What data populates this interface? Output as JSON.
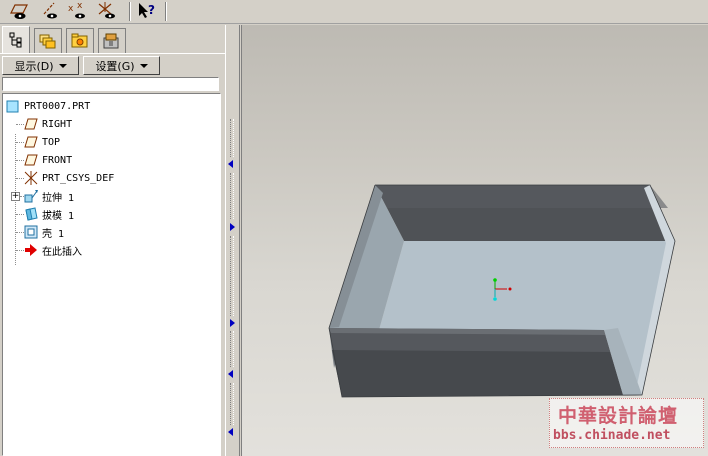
{
  "toolbar": {
    "buttons": [
      {
        "icon": "datum-plane-display-icon"
      },
      {
        "icon": "datum-axis-display-icon"
      },
      {
        "icon": "datum-point-display-icon"
      },
      {
        "icon": "csys-display-icon"
      },
      {
        "icon": "context-help-icon"
      }
    ]
  },
  "left_panel": {
    "tabs": [
      {
        "icon": "model-tree-icon",
        "active": true
      },
      {
        "icon": "folder-browser-icon",
        "active": false
      },
      {
        "icon": "favorites-icon",
        "active": false
      },
      {
        "icon": "connections-icon",
        "active": false
      }
    ],
    "show_menu_label": "显示(D)",
    "settings_menu_label": "设置(G)",
    "tree": {
      "root": "PRT0007.PRT",
      "items": [
        {
          "label": "RIGHT",
          "icon": "datum-plane-icon"
        },
        {
          "label": "TOP",
          "icon": "datum-plane-icon"
        },
        {
          "label": "FRONT",
          "icon": "datum-plane-icon"
        },
        {
          "label": "PRT_CSYS_DEF",
          "icon": "coordinate-system-icon"
        },
        {
          "label": "拉伸 1",
          "icon": "extrude-icon",
          "expandable": true
        },
        {
          "label": "拔模 1",
          "icon": "draft-icon"
        },
        {
          "label": "壳 1",
          "icon": "shell-icon"
        },
        {
          "label": "在此插入",
          "icon": "insert-here-arrow-icon"
        }
      ]
    }
  },
  "colors": {
    "ui_bg": "#d4d0c8",
    "model_dark": "#4d5054",
    "model_light": "#b5c2cb",
    "watermark": "#d06070"
  },
  "watermark": {
    "title": "中華設計論壇",
    "url": "bbs.chinade.net"
  }
}
